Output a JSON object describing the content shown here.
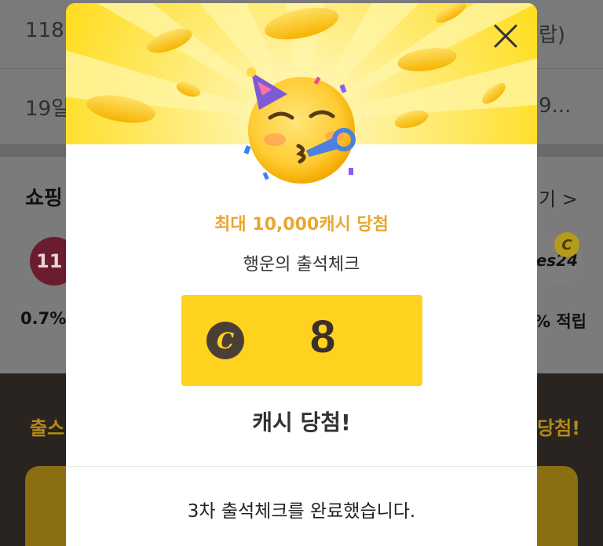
{
  "background": {
    "row1_left": "118",
    "row1_right": "랍)",
    "row2_left": "19일",
    "row2_right": "9...",
    "shopping_title": "쇼핑",
    "shopping_more": "기 >",
    "left_circle_text": "11",
    "right_circle_text": "es24",
    "coin_badge": "C",
    "left_rate": "0.7%",
    "right_rate": "% 적립",
    "attendance_left": "출스",
    "attendance_right": "당첨!"
  },
  "modal": {
    "max_cash_text": "최대 10,000캐시 당첨",
    "subtitle": "행운의 출석체크",
    "coin_symbol": "C",
    "cash_amount": "8",
    "result_text": "캐시 당첨!",
    "footer_text": "3차 출석체크를 완료했습니다.",
    "icons": {
      "close": "close-icon",
      "emoji": "party-face-emoji-icon",
      "coin": "cash-coin-icon"
    }
  },
  "colors": {
    "header_yellow": "#ffdd1f",
    "cash_box": "#ffd21f",
    "accent_orange": "#e9a630",
    "coin_dark": "#4a3f37"
  }
}
